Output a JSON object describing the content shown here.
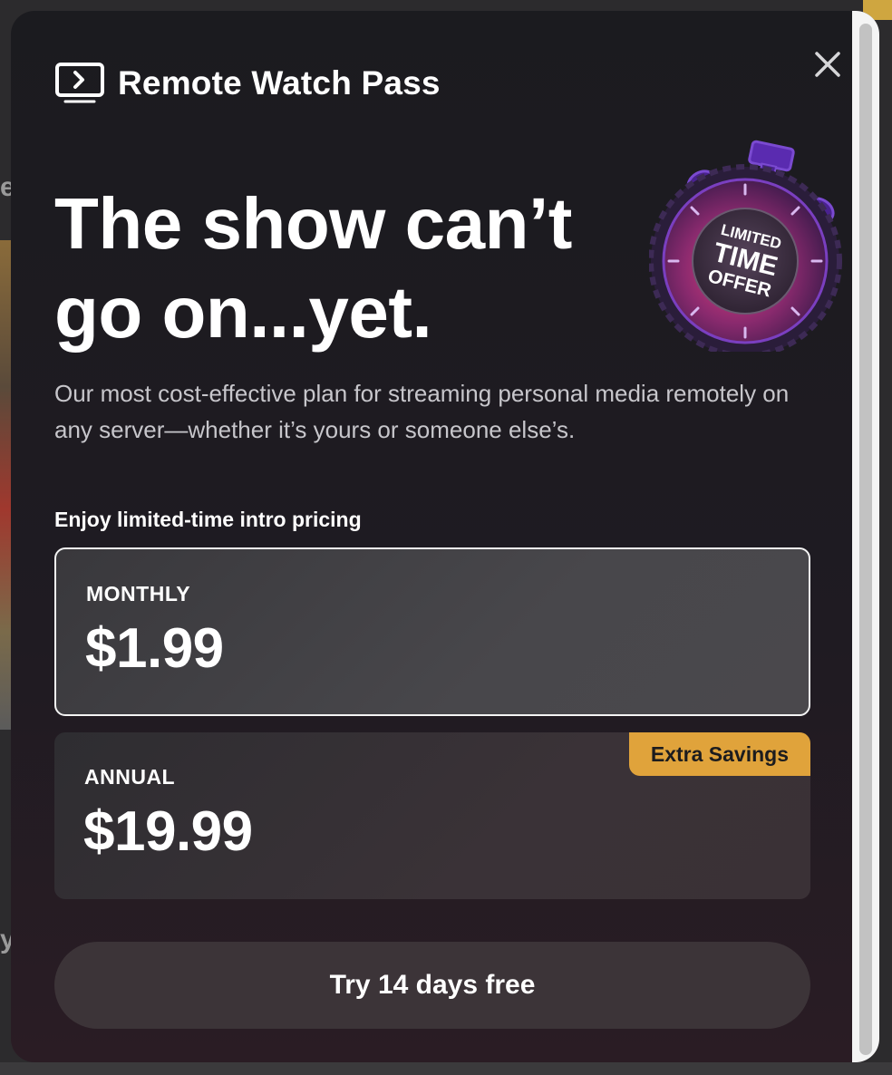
{
  "modal": {
    "brand_name": "Remote Watch Pass",
    "headline_line1": "The show can’t",
    "headline_line2": "go on...yet.",
    "description": "Our most cost-effective plan for streaming personal media remotely on any server—whether it’s yours or someone else’s.",
    "intro_pricing": "Enjoy limited-time intro pricing",
    "badge": {
      "line1": "LIMITED",
      "line2": "TIME",
      "line3": "OFFER"
    },
    "plans": [
      {
        "label": "MONTHLY",
        "price": "$1.99",
        "selected": true
      },
      {
        "label": "ANNUAL",
        "price": "$19.99",
        "tag": "Extra Savings",
        "selected": false
      }
    ],
    "cta_label": "Try 14 days free"
  },
  "background": {
    "glyph_top": "e",
    "glyph_bottom": "y"
  },
  "icons": {
    "brand": "tv-play-icon",
    "close": "close-icon",
    "badge": "stopwatch-badge-icon"
  },
  "colors": {
    "modal_bg": "#1b1b1f",
    "accent_tag": "#e0a33b",
    "badge_purple": "#5a2b9a",
    "badge_pink": "#d23a7a",
    "text_primary": "#ffffff",
    "text_secondary": "#c7c6cb"
  }
}
